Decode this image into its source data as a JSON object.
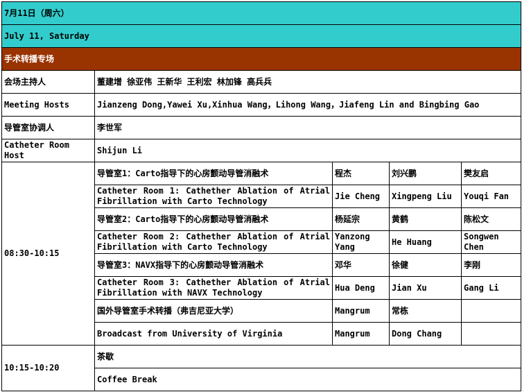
{
  "colors": {
    "teal_header": "#33CCCC",
    "brown_header": "#993300"
  },
  "header": {
    "date_cn": "7月11日（周六）",
    "date_en": "July 11, Saturday",
    "session_title": "手术转播专场"
  },
  "info": {
    "hosts_cn_label": "会场主持人",
    "hosts_cn": "董建增 徐亚伟 王新华 王利宏 林加锋 高兵兵",
    "hosts_en_label": "Meeting Hosts",
    "hosts_en": "Jianzeng Dong,Yawei Xu,Xinhua Wang，Lihong Wang，Jiafeng Lin and Bingbing Gao",
    "coord_cn_label": "导管室协调人",
    "coord_cn": "李世军",
    "coord_en_label": "Catheter Room Host",
    "coord_en": "Shijun Li"
  },
  "block1": {
    "time": "08:30-10:15",
    "rows": [
      {
        "title": "导管室1：Carto指导下的心房颤动导管消融术",
        "p1": "程杰",
        "p2": "刘兴鹏",
        "p3": "樊友启"
      },
      {
        "title": "Catheter Room 1: Cathether Ablation of Atrial Fibrillation with Carto Technology",
        "p1": "Jie Cheng",
        "p2": "Xingpeng Liu",
        "p3": "Youqi Fan"
      },
      {
        "title": "导管室2：Carto指导下的心房颤动导管消融术",
        "p1": "杨延宗",
        "p2": "黄鹤",
        "p3": "陈松文"
      },
      {
        "title": "Catheter Room 2: Cathether Ablation of Atrial Fibrillation with Carto Technology",
        "p1": "Yanzong Yang",
        "p2": "He Huang",
        "p3": "Songwen Chen"
      },
      {
        "title": "导管室3：NAVX指导下的心房颤动导管消融术",
        "p1": "邓华",
        "p2": "徐健",
        "p3": "李刚"
      },
      {
        "title": "Catheter Room 3: Cathether Ablation of Atrial Fibrillation with NAVX Technology",
        "p1": "Hua Deng",
        "p2": "Jian Xu",
        "p3": "Gang Li"
      },
      {
        "title": "国外导管室手术转播（弗吉尼亚大学）",
        "p1": "Mangrum",
        "p2": "常栋",
        "p3": ""
      },
      {
        "title": "Broadcast from University of Virginia",
        "p1": "Mangrum",
        "p2": "Dong Chang",
        "p3": ""
      }
    ]
  },
  "block2": {
    "time": "10:15-10:20",
    "break_cn": "茶歇",
    "break_en": "Coffee Break"
  }
}
